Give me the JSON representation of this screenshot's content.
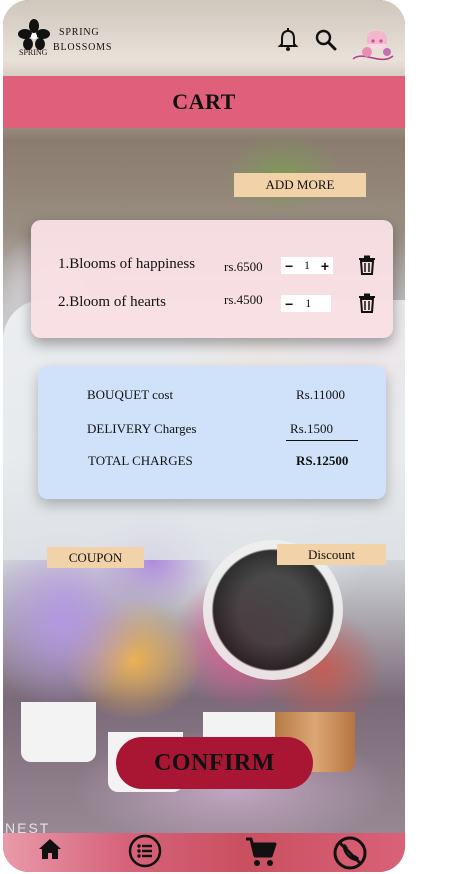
{
  "brand": {
    "name_line1": "SPRING",
    "name_line2": "BLOSSOMS",
    "mark_text": "SPRING"
  },
  "header": {
    "title": "CART"
  },
  "actions": {
    "add_more": "ADD MORE",
    "coupon": "COUPON",
    "discount": "Discount",
    "confirm": "CONFIRM"
  },
  "cart": {
    "items": [
      {
        "name": "1.Blooms of happiness",
        "price": "rs.6500",
        "qty": "1"
      },
      {
        "name": "2.Bloom of hearts",
        "price": "rs.4500",
        "qty": "1"
      }
    ]
  },
  "summary": {
    "bouquet_label": "BOUQUET cost",
    "bouquet_value": "Rs.11000",
    "delivery_label": "DELIVERY Charges",
    "delivery_value": "Rs.1500",
    "total_label": "TOTAL CHARGES",
    "total_value": "RS.12500"
  },
  "photo_text": "NEST",
  "icons": {
    "header": [
      "bell-icon",
      "search-icon",
      "avatar"
    ],
    "nav": [
      "home-icon",
      "list-icon",
      "cart-icon",
      "phone-icon"
    ]
  },
  "colors": {
    "header_bar": "#e0607b",
    "confirm": "#a81634",
    "tag": "#f2d2a8",
    "items_card": "#f8dfe4",
    "summary_card": "#cee1fa"
  }
}
